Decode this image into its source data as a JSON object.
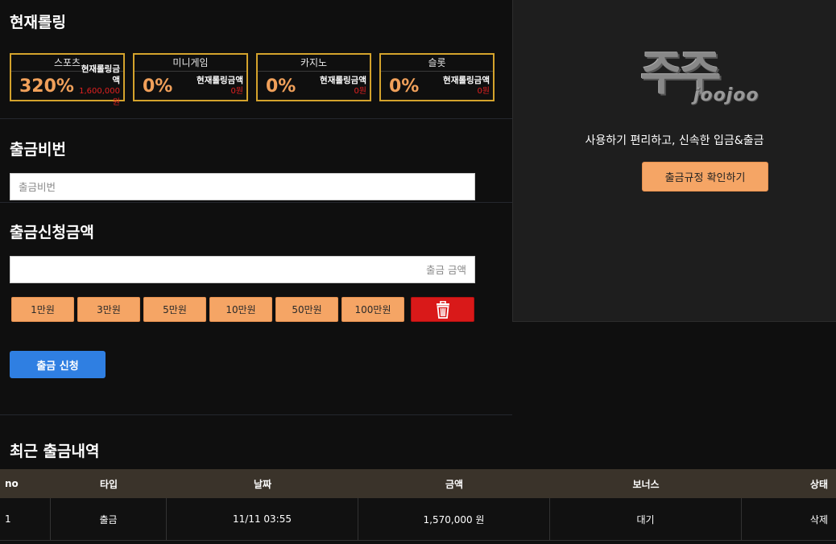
{
  "rolling": {
    "title": "현재롤링",
    "cards": [
      {
        "name": "스포츠",
        "percent": "320%",
        "label": "현재롤링금액",
        "amount": "1,600,000원"
      },
      {
        "name": "미니게임",
        "percent": "0%",
        "label": "현재롤링금액",
        "amount": "0원"
      },
      {
        "name": "카지노",
        "percent": "0%",
        "label": "현재롤링금액",
        "amount": "0원"
      },
      {
        "name": "슬롯",
        "percent": "0%",
        "label": "현재롤링금액",
        "amount": "0원"
      }
    ]
  },
  "password": {
    "title": "출금비번",
    "placeholder": "출금비번",
    "value": ""
  },
  "amount": {
    "title": "출금신청금액",
    "placeholder": "출금 금액",
    "value": "",
    "buttons": [
      "1만원",
      "3만원",
      "5만원",
      "10만원",
      "50만원",
      "100만원"
    ]
  },
  "submit_label": "출금 신청",
  "panel": {
    "logo_main": "주주",
    "logo_sub": "joojoo",
    "tagline": "사용하기 편리하고, 신속한 입금&출금",
    "rules_button": "출금규정 확인하기"
  },
  "history": {
    "title": "최근 출금내역",
    "columns": [
      "no",
      "타입",
      "날짜",
      "금액",
      "보너스",
      "상태"
    ],
    "rows": [
      {
        "no": "1",
        "type": "출금",
        "date": "11/11 03:55",
        "amount": "1,570,000 원",
        "bonus": "대기",
        "status": "삭제"
      }
    ]
  },
  "colors": {
    "accent": "#f5a565",
    "border_gold": "#d4a32c",
    "submit": "#2f7fe2",
    "danger": "#d91919"
  }
}
